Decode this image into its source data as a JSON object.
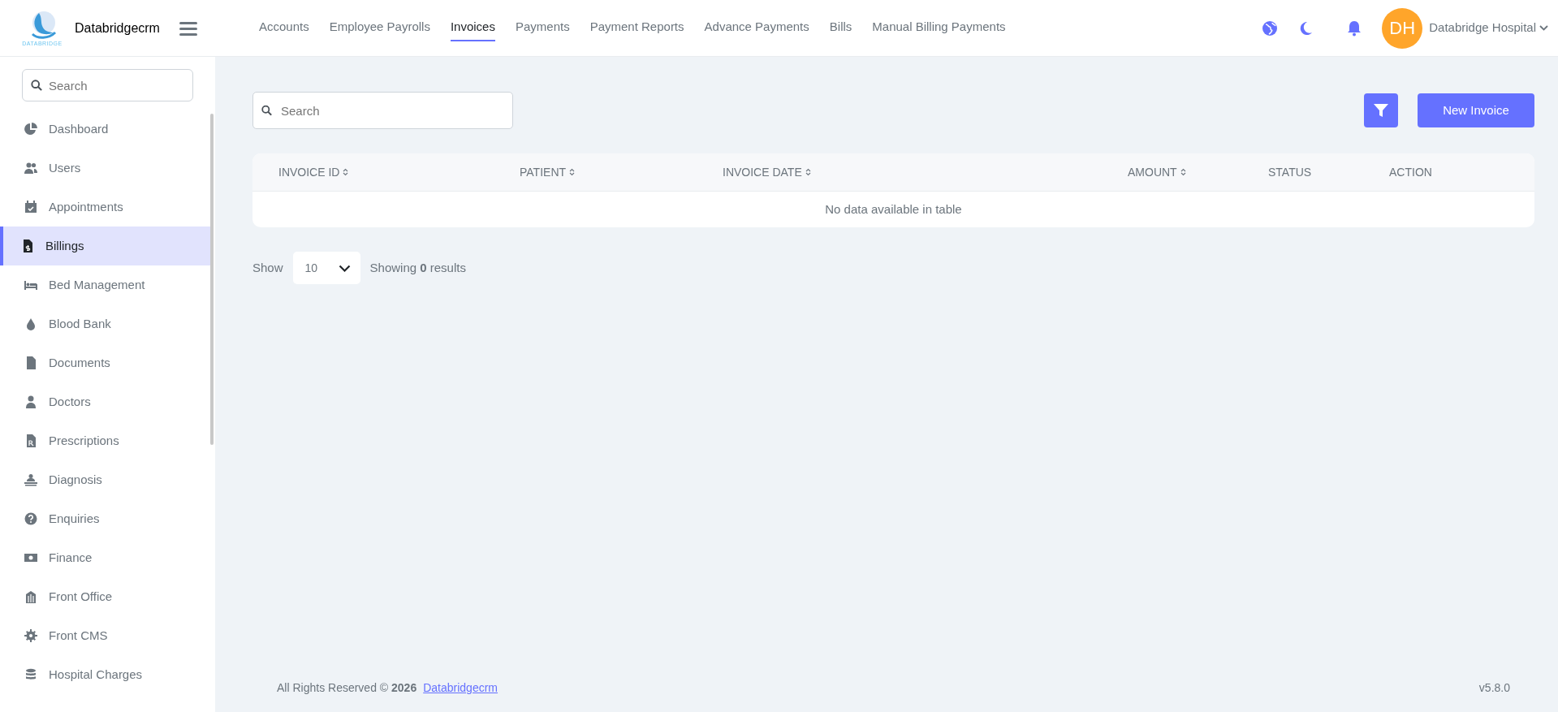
{
  "sidebar": {
    "brand": "Databridgecrm",
    "logo_text": "DATABRIDGE",
    "search": {
      "placeholder": "Search"
    },
    "items": [
      {
        "label": "Dashboard",
        "selected": false
      },
      {
        "label": "Users",
        "selected": false
      },
      {
        "label": "Appointments",
        "selected": false
      },
      {
        "label": "Billings",
        "selected": true
      },
      {
        "label": "Bed Management",
        "selected": false
      },
      {
        "label": "Blood Bank",
        "selected": false
      },
      {
        "label": "Documents",
        "selected": false
      },
      {
        "label": "Doctors",
        "selected": false
      },
      {
        "label": "Prescriptions",
        "selected": false
      },
      {
        "label": "Diagnosis",
        "selected": false
      },
      {
        "label": "Enquiries",
        "selected": false
      },
      {
        "label": "Finance",
        "selected": false
      },
      {
        "label": "Front Office",
        "selected": false
      },
      {
        "label": "Front CMS",
        "selected": false
      },
      {
        "label": "Hospital Charges",
        "selected": false
      }
    ]
  },
  "topnav": {
    "tabs": [
      {
        "label": "Accounts",
        "selected": false
      },
      {
        "label": "Employee Payrolls",
        "selected": false
      },
      {
        "label": "Invoices",
        "selected": true
      },
      {
        "label": "Payments",
        "selected": false
      },
      {
        "label": "Payment Reports",
        "selected": false
      },
      {
        "label": "Advance Payments",
        "selected": false
      },
      {
        "label": "Bills",
        "selected": false
      },
      {
        "label": "Manual Billing Payments",
        "selected": false
      }
    ],
    "user": {
      "initials": "DH",
      "name": "Databridge Hospital"
    }
  },
  "toolbar": {
    "search": {
      "placeholder": "Search"
    },
    "new_button": "New Invoice"
  },
  "table": {
    "columns": [
      {
        "label": "INVOICE ID",
        "sortable": true
      },
      {
        "label": "PATIENT",
        "sortable": true
      },
      {
        "label": "INVOICE DATE",
        "sortable": true
      },
      {
        "label": "AMOUNT",
        "sortable": true
      },
      {
        "label": "STATUS",
        "sortable": false
      },
      {
        "label": "ACTION",
        "sortable": false
      }
    ],
    "empty_message": "No data available in table"
  },
  "pagination": {
    "show_label": "Show",
    "page_size": "10",
    "summary": "Showing **0** results"
  },
  "footer": {
    "copyright": "All Rights Reserved © **2026**",
    "link": "Databridgecrm",
    "version": "v5.8.0"
  }
}
